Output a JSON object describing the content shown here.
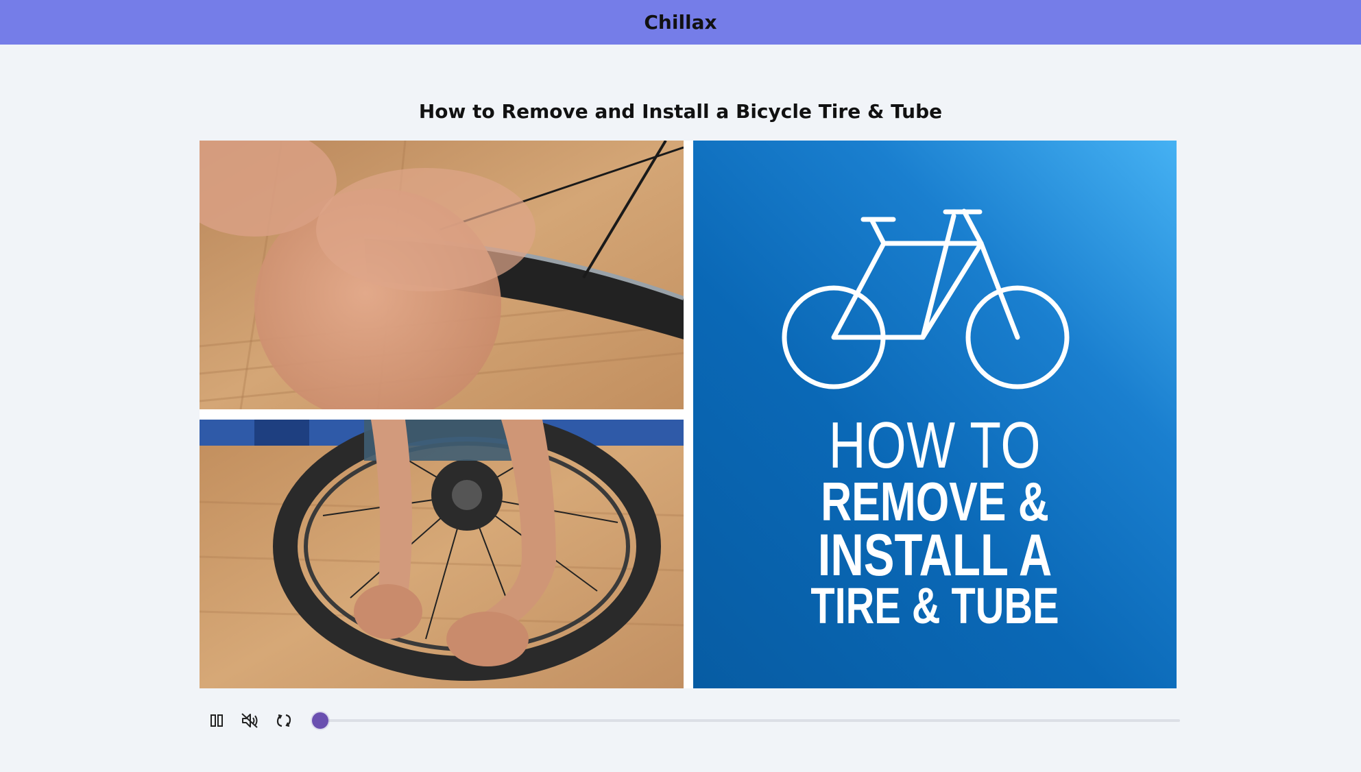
{
  "app": {
    "title": "Chillax"
  },
  "video": {
    "title": "How to Remove and Install a Bicycle Tire & Tube",
    "poster": {
      "line1": "HOW TO",
      "line2": "REMOVE &",
      "line3": "INSTALL A",
      "line4": "TIRE & TUBE"
    }
  },
  "controls": {
    "pause_icon": "pause-icon",
    "mute_icon": "volume-muted-icon",
    "replay_icon": "replay-icon",
    "progress": 0.0
  },
  "colors": {
    "header": "#757de8",
    "background": "#f1f4f8",
    "accent": "#6a4fb0"
  }
}
